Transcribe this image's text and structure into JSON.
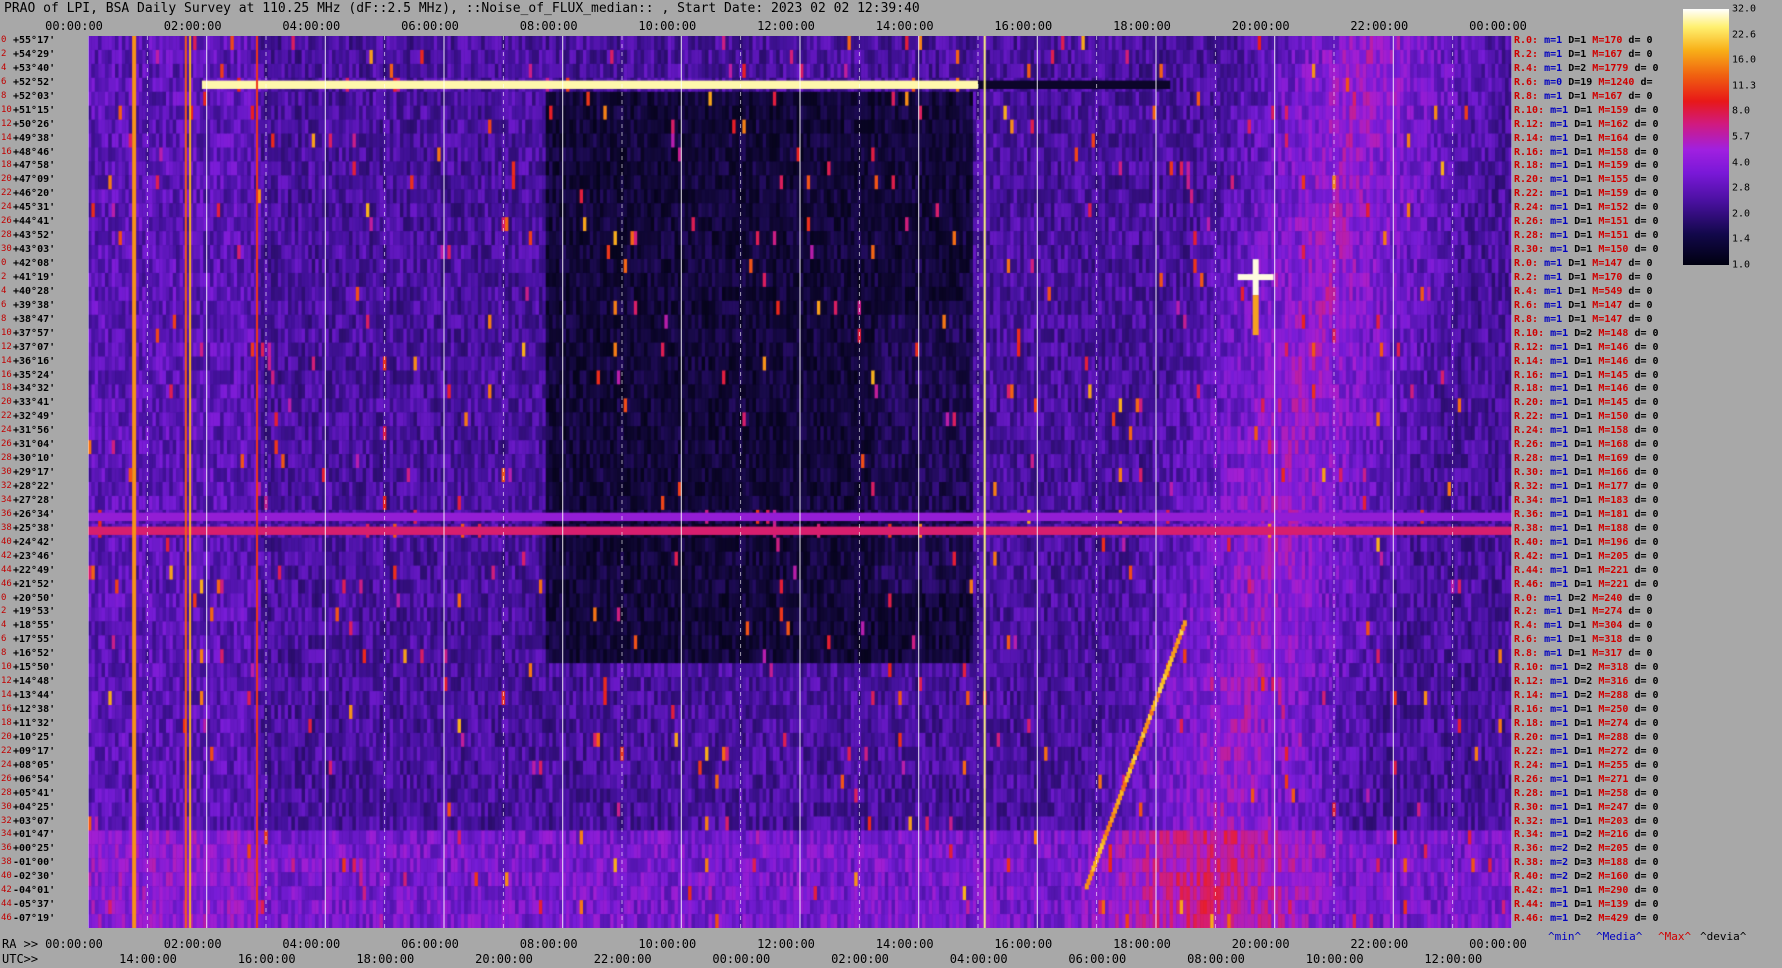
{
  "title": "PRAO of LPI, BSA Daily Survey at 110.25 MHz (dF::2.5 MHz), ::Noise_of_FLUX_median:: , Start Date: 2023 02 02 12:39:40",
  "top_ticks": [
    "00:00:00",
    "02:00:00",
    "04:00:00",
    "06:00:00",
    "08:00:00",
    "10:00:00",
    "12:00:00",
    "14:00:00",
    "16:00:00",
    "18:00:00",
    "20:00:00",
    "22:00:00",
    "00:00:00"
  ],
  "ra_label": "RA >>",
  "ra_ticks": [
    "00:00:00",
    "02:00:00",
    "04:00:00",
    "06:00:00",
    "08:00:00",
    "10:00:00",
    "12:00:00",
    "14:00:00",
    "16:00:00",
    "18:00:00",
    "20:00:00",
    "22:00:00",
    "00:00:00"
  ],
  "utc_label": "UTC>>",
  "utc_ticks": [
    "14:00:00",
    "16:00:00",
    "18:00:00",
    "20:00:00",
    "22:00:00",
    "00:00:00",
    "02:00:00",
    "04:00:00",
    "06:00:00",
    "08:00:00",
    "10:00:00",
    "12:00:00"
  ],
  "beam_numbers": [
    "0",
    "2",
    "4",
    "6",
    "8",
    "10",
    "12",
    "14",
    "16",
    "18",
    "20",
    "22",
    "24",
    "26",
    "28",
    "30",
    "0",
    "2",
    "4",
    "6",
    "8",
    "10",
    "12",
    "14",
    "16",
    "18",
    "20",
    "22",
    "24",
    "26",
    "28",
    "30",
    "32",
    "34",
    "36",
    "38",
    "40",
    "42",
    "44",
    "46",
    "0",
    "2",
    "4",
    "6",
    "8",
    "10",
    "12",
    "14",
    "16",
    "18",
    "20",
    "22",
    "24",
    "26",
    "28",
    "30",
    "32",
    "34",
    "36",
    "38",
    "40",
    "42",
    "44",
    "46"
  ],
  "declinations": [
    "+55°17'",
    "+54°29'",
    "+53°40'",
    "+52°52'",
    "+52°03'",
    "+51°15'",
    "+50°26'",
    "+49°38'",
    "+48°46'",
    "+47°58'",
    "+47°09'",
    "+46°20'",
    "+45°31'",
    "+44°41'",
    "+43°52'",
    "+43°03'",
    "+42°08'",
    "+41°19'",
    "+40°28'",
    "+39°38'",
    "+38°47'",
    "+37°57'",
    "+37°07'",
    "+36°16'",
    "+35°24'",
    "+34°32'",
    "+33°41'",
    "+32°49'",
    "+31°56'",
    "+31°04'",
    "+30°10'",
    "+29°17'",
    "+28°22'",
    "+27°28'",
    "+26°34'",
    "+25°38'",
    "+24°42'",
    "+23°46'",
    "+22°49'",
    "+21°52'",
    "+20°50'",
    "+19°53'",
    "+18°55'",
    "+17°55'",
    "+16°52'",
    "+15°50'",
    "+14°48'",
    "+13°44'",
    "+12°38'",
    "+11°32'",
    "+10°25'",
    "+09°17'",
    "+08°05'",
    "+06°54'",
    "+05°41'",
    "+04°25'",
    "+03°07'",
    "+01°47'",
    "+00°25'",
    "-01°00'",
    "-02°30'",
    "-04°01'",
    "-05°37'",
    "-07°19'"
  ],
  "right_rows": [
    {
      "r": "R.0:",
      "m": "m=1",
      "D": "D=1",
      "M": "M=170",
      "d": "d= 0"
    },
    {
      "r": "R.2:",
      "m": "m=1",
      "D": "D=1",
      "M": "M=167",
      "d": "d= 0"
    },
    {
      "r": "R.4:",
      "m": "m=1",
      "D": "D=2",
      "M": "M=1779",
      "d": "d= 0"
    },
    {
      "r": "R.6:",
      "m": "m=0",
      "D": "D=19",
      "M": "M=1240",
      "d": "d="
    },
    {
      "r": "R.8:",
      "m": "m=1",
      "D": "D=1",
      "M": "M=167",
      "d": "d= 0"
    },
    {
      "r": "R.10:",
      "m": "m=1",
      "D": "D=1",
      "M": "M=159",
      "d": "d= 0"
    },
    {
      "r": "R.12:",
      "m": "m=1",
      "D": "D=1",
      "M": "M=162",
      "d": "d= 0"
    },
    {
      "r": "R.14:",
      "m": "m=1",
      "D": "D=1",
      "M": "M=164",
      "d": "d= 0"
    },
    {
      "r": "R.16:",
      "m": "m=1",
      "D": "D=1",
      "M": "M=158",
      "d": "d= 0"
    },
    {
      "r": "R.18:",
      "m": "m=1",
      "D": "D=1",
      "M": "M=159",
      "d": "d= 0"
    },
    {
      "r": "R.20:",
      "m": "m=1",
      "D": "D=1",
      "M": "M=155",
      "d": "d= 0"
    },
    {
      "r": "R.22:",
      "m": "m=1",
      "D": "D=1",
      "M": "M=159",
      "d": "d= 0"
    },
    {
      "r": "R.24:",
      "m": "m=1",
      "D": "D=1",
      "M": "M=152",
      "d": "d= 0"
    },
    {
      "r": "R.26:",
      "m": "m=1",
      "D": "D=1",
      "M": "M=151",
      "d": "d= 0"
    },
    {
      "r": "R.28:",
      "m": "m=1",
      "D": "D=1",
      "M": "M=151",
      "d": "d= 0"
    },
    {
      "r": "R.30:",
      "m": "m=1",
      "D": "D=1",
      "M": "M=150",
      "d": "d= 0"
    },
    {
      "r": "R.0:",
      "m": "m=1",
      "D": "D=1",
      "M": "M=147",
      "d": "d= 0"
    },
    {
      "r": "R.2:",
      "m": "m=1",
      "D": "D=1",
      "M": "M=170",
      "d": "d= 0"
    },
    {
      "r": "R.4:",
      "m": "m=1",
      "D": "D=1",
      "M": "M=549",
      "d": "d= 0"
    },
    {
      "r": "R.6:",
      "m": "m=1",
      "D": "D=1",
      "M": "M=147",
      "d": "d= 0"
    },
    {
      "r": "R.8:",
      "m": "m=1",
      "D": "D=1",
      "M": "M=147",
      "d": "d= 0"
    },
    {
      "r": "R.10:",
      "m": "m=1",
      "D": "D=2",
      "M": "M=148",
      "d": "d= 0"
    },
    {
      "r": "R.12:",
      "m": "m=1",
      "D": "D=1",
      "M": "M=146",
      "d": "d= 0"
    },
    {
      "r": "R.14:",
      "m": "m=1",
      "D": "D=1",
      "M": "M=146",
      "d": "d= 0"
    },
    {
      "r": "R.16:",
      "m": "m=1",
      "D": "D=1",
      "M": "M=145",
      "d": "d= 0"
    },
    {
      "r": "R.18:",
      "m": "m=1",
      "D": "D=1",
      "M": "M=146",
      "d": "d= 0"
    },
    {
      "r": "R.20:",
      "m": "m=1",
      "D": "D=1",
      "M": "M=145",
      "d": "d= 0"
    },
    {
      "r": "R.22:",
      "m": "m=1",
      "D": "D=1",
      "M": "M=150",
      "d": "d= 0"
    },
    {
      "r": "R.24:",
      "m": "m=1",
      "D": "D=1",
      "M": "M=158",
      "d": "d= 0"
    },
    {
      "r": "R.26:",
      "m": "m=1",
      "D": "D=1",
      "M": "M=168",
      "d": "d= 0"
    },
    {
      "r": "R.28:",
      "m": "m=1",
      "D": "D=1",
      "M": "M=169",
      "d": "d= 0"
    },
    {
      "r": "R.30:",
      "m": "m=1",
      "D": "D=1",
      "M": "M=166",
      "d": "d= 0"
    },
    {
      "r": "R.32:",
      "m": "m=1",
      "D": "D=1",
      "M": "M=177",
      "d": "d= 0"
    },
    {
      "r": "R.34:",
      "m": "m=1",
      "D": "D=1",
      "M": "M=183",
      "d": "d= 0"
    },
    {
      "r": "R.36:",
      "m": "m=1",
      "D": "D=1",
      "M": "M=181",
      "d": "d= 0"
    },
    {
      "r": "R.38:",
      "m": "m=1",
      "D": "D=1",
      "M": "M=188",
      "d": "d= 0"
    },
    {
      "r": "R.40:",
      "m": "m=1",
      "D": "D=1",
      "M": "M=196",
      "d": "d= 0"
    },
    {
      "r": "R.42:",
      "m": "m=1",
      "D": "D=1",
      "M": "M=205",
      "d": "d= 0"
    },
    {
      "r": "R.44:",
      "m": "m=1",
      "D": "D=1",
      "M": "M=221",
      "d": "d= 0"
    },
    {
      "r": "R.46:",
      "m": "m=1",
      "D": "D=1",
      "M": "M=221",
      "d": "d= 0"
    },
    {
      "r": "R.0:",
      "m": "m=1",
      "D": "D=2",
      "M": "M=240",
      "d": "d= 0"
    },
    {
      "r": "R.2:",
      "m": "m=1",
      "D": "D=1",
      "M": "M=274",
      "d": "d= 0"
    },
    {
      "r": "R.4:",
      "m": "m=1",
      "D": "D=1",
      "M": "M=304",
      "d": "d= 0"
    },
    {
      "r": "R.6:",
      "m": "m=1",
      "D": "D=1",
      "M": "M=318",
      "d": "d= 0"
    },
    {
      "r": "R.8:",
      "m": "m=1",
      "D": "D=1",
      "M": "M=317",
      "d": "d= 0"
    },
    {
      "r": "R.10:",
      "m": "m=1",
      "D": "D=2",
      "M": "M=318",
      "d": "d= 0"
    },
    {
      "r": "R.12:",
      "m": "m=1",
      "D": "D=2",
      "M": "M=316",
      "d": "d= 0"
    },
    {
      "r": "R.14:",
      "m": "m=1",
      "D": "D=2",
      "M": "M=288",
      "d": "d= 0"
    },
    {
      "r": "R.16:",
      "m": "m=1",
      "D": "D=1",
      "M": "M=250",
      "d": "d= 0"
    },
    {
      "r": "R.18:",
      "m": "m=1",
      "D": "D=1",
      "M": "M=274",
      "d": "d= 0"
    },
    {
      "r": "R.20:",
      "m": "m=1",
      "D": "D=1",
      "M": "M=288",
      "d": "d= 0"
    },
    {
      "r": "R.22:",
      "m": "m=1",
      "D": "D=1",
      "M": "M=272",
      "d": "d= 0"
    },
    {
      "r": "R.24:",
      "m": "m=1",
      "D": "D=1",
      "M": "M=255",
      "d": "d= 0"
    },
    {
      "r": "R.26:",
      "m": "m=1",
      "D": "D=1",
      "M": "M=271",
      "d": "d= 0"
    },
    {
      "r": "R.28:",
      "m": "m=1",
      "D": "D=1",
      "M": "M=258",
      "d": "d= 0"
    },
    {
      "r": "R.30:",
      "m": "m=1",
      "D": "D=1",
      "M": "M=247",
      "d": "d= 0"
    },
    {
      "r": "R.32:",
      "m": "m=1",
      "D": "D=1",
      "M": "M=203",
      "d": "d= 0"
    },
    {
      "r": "R.34:",
      "m": "m=1",
      "D": "D=2",
      "M": "M=216",
      "d": "d= 0"
    },
    {
      "r": "R.36:",
      "m": "m=2",
      "D": "D=2",
      "M": "M=205",
      "d": "d= 0"
    },
    {
      "r": "R.38:",
      "m": "m=2",
      "D": "D=3",
      "M": "M=188",
      "d": "d= 0"
    },
    {
      "r": "R.40:",
      "m": "m=2",
      "D": "D=2",
      "M": "M=160",
      "d": "d= 0"
    },
    {
      "r": "R.42:",
      "m": "m=1",
      "D": "D=1",
      "M": "M=290",
      "d": "d= 0"
    },
    {
      "r": "R.44:",
      "m": "m=1",
      "D": "D=1",
      "M": "M=139",
      "d": "d= 0"
    },
    {
      "r": "R.46:",
      "m": "m=1",
      "D": "D=2",
      "M": "M=429",
      "d": "d= 0"
    }
  ],
  "colorbar_ticks": [
    "32.0",
    "22.6",
    "16.0",
    "11.3",
    "8.0",
    "5.7",
    "4.0",
    "2.8",
    "2.0",
    "1.4",
    "1.0"
  ],
  "legend": {
    "min": "^min^",
    "media": "^Media^",
    "max": "^Max^",
    "devia": "^devia^"
  },
  "colors": {
    "background": "#a8a8a8",
    "beam_label": "#c00000",
    "min": "#0000c0",
    "max": "#d00000"
  },
  "chart_data": {
    "type": "heatmap",
    "title": "PRAO of LPI, BSA Daily Survey at 110.25 MHz (dF::2.5 MHz), ::Noise_of_FLUX_median:: , Start Date: 2023 02 02 12:39:40",
    "x_axis": "RA 00:00:00 to 24:00:00 (UTC 12:39:40 to 12:39:40 next day)",
    "y_axis": "Declination +55°17' to -07°19' (64 beams)",
    "color_scale": {
      "type": "log",
      "min": 1.0,
      "max": 32.0
    },
    "features": [
      {
        "name": "strong horizontal band",
        "declination": "+52°52'",
        "ra_start": "02:00:00",
        "ra_end": "15:40:00",
        "level": 32.0
      },
      {
        "name": "horizontal band",
        "declination": "+25°38'",
        "ra_start": "00:00:00",
        "ra_end": "24:00:00",
        "level": 5.7
      },
      {
        "name": "bright vertical line",
        "ra": "01:15:00",
        "level": 11.3
      },
      {
        "name": "bright source",
        "ra": "19:55:00",
        "declination": "+40°28'",
        "level": 32.0
      },
      {
        "name": "galactic plane diagonal",
        "ra_start": "17:40:00",
        "ra_end": "19:20:00",
        "level": 11.3
      }
    ]
  }
}
